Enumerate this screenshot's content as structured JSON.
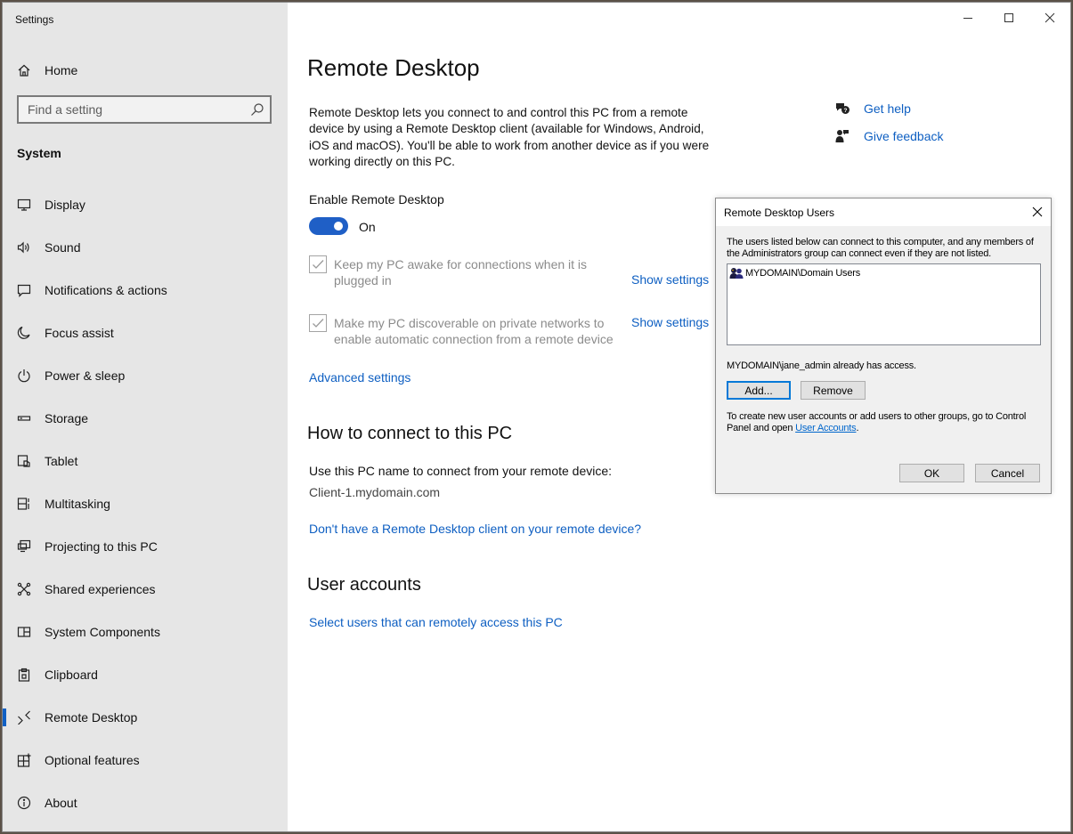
{
  "window": {
    "app_title": "Settings",
    "controls": {
      "minimize_icon": "minimize-icon",
      "maximize_icon": "maximize-icon",
      "close_icon": "close-icon"
    }
  },
  "sidebar": {
    "home_label": "Home",
    "search_placeholder": "Find a setting",
    "section_label": "System",
    "items": [
      {
        "label": "Display",
        "icon": "display-icon"
      },
      {
        "label": "Sound",
        "icon": "sound-icon"
      },
      {
        "label": "Notifications & actions",
        "icon": "notifications-icon"
      },
      {
        "label": "Focus assist",
        "icon": "focus-assist-icon"
      },
      {
        "label": "Power & sleep",
        "icon": "power-icon"
      },
      {
        "label": "Storage",
        "icon": "storage-icon"
      },
      {
        "label": "Tablet",
        "icon": "tablet-icon"
      },
      {
        "label": "Multitasking",
        "icon": "multitasking-icon"
      },
      {
        "label": "Projecting to this PC",
        "icon": "projecting-icon"
      },
      {
        "label": "Shared experiences",
        "icon": "shared-experiences-icon"
      },
      {
        "label": "System Components",
        "icon": "system-components-icon"
      },
      {
        "label": "Clipboard",
        "icon": "clipboard-icon"
      },
      {
        "label": "Remote Desktop",
        "icon": "remote-desktop-icon",
        "selected": true
      },
      {
        "label": "Optional features",
        "icon": "optional-features-icon"
      },
      {
        "label": "About",
        "icon": "about-icon"
      }
    ],
    "accent_color": "#1060c4"
  },
  "main": {
    "title": "Remote Desktop",
    "description": "Remote Desktop lets you connect to and control this PC from a remote device by using a Remote Desktop client (available for Windows, Android, iOS and macOS). You'll be able to work from another device as if you were working directly on this PC.",
    "help": {
      "get_help": "Get help",
      "give_feedback": "Give feedback"
    },
    "enable_label": "Enable Remote Desktop",
    "toggle_state": "On",
    "keep_awake": {
      "label": "Keep my PC awake for connections when it is plugged in",
      "checked": true,
      "link": "Show settings"
    },
    "discoverable": {
      "label": "Make my PC discoverable on private networks to enable automatic connection from a remote device",
      "checked": true,
      "link": "Show settings"
    },
    "advanced_link": "Advanced settings",
    "connect_heading": "How to connect to this PC",
    "connect_text": "Use this PC name to connect from your remote device:",
    "pc_name": "Client-1.mydomain.com",
    "client_link": "Don't have a Remote Desktop client on your remote device?",
    "accounts_heading": "User accounts",
    "accounts_link": "Select users that can remotely access this PC",
    "link_color": "#0e5fc2",
    "toggle_color": "#1f5fc6"
  },
  "dialog": {
    "title": "Remote Desktop Users",
    "intro": "The users listed below can connect to this computer, and any members of the Administrators group can connect even if they are not listed.",
    "users": [
      "MYDOMAIN\\Domain Users"
    ],
    "access_note": "MYDOMAIN\\jane_admin already has access.",
    "add_button": "Add...",
    "remove_button": "Remove",
    "footer_text": "To create new user accounts or add users to other groups, go to Control Panel and open",
    "footer_link": "User Accounts",
    "footer_end": ".",
    "ok_button": "OK",
    "cancel_button": "Cancel"
  }
}
